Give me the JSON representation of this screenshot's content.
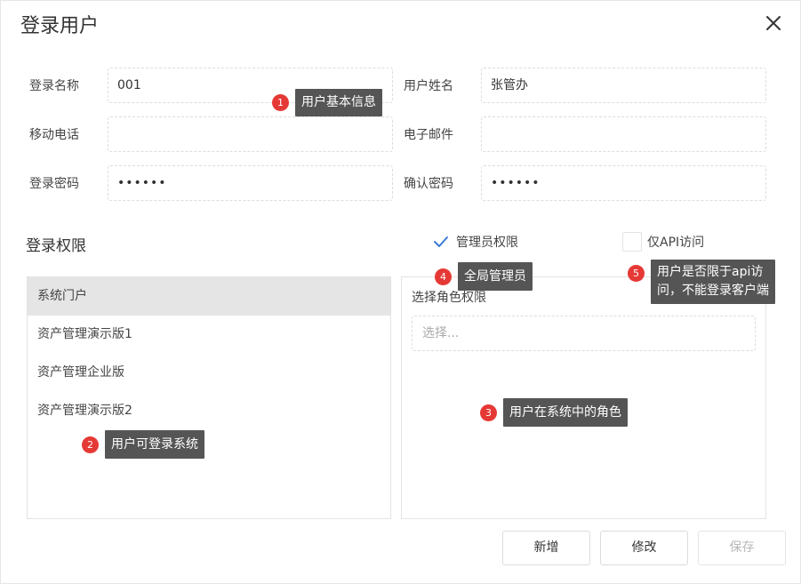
{
  "dialog": {
    "title": "登录用户"
  },
  "form": {
    "login_name": {
      "label": "登录名称",
      "value": "001"
    },
    "user_name": {
      "label": "用户姓名",
      "value": "张管办"
    },
    "mobile": {
      "label": "移动电话",
      "value": ""
    },
    "email": {
      "label": "电子邮件",
      "value": ""
    },
    "password": {
      "label": "登录密码",
      "value": "••••••"
    },
    "confirm_password": {
      "label": "确认密码",
      "value": "••••••"
    }
  },
  "permissions": {
    "title": "登录权限",
    "admin": {
      "label": "管理员权限",
      "checked": true
    },
    "api_only": {
      "label": "仅API访问",
      "checked": false
    },
    "systems": [
      "系统门户",
      "资产管理演示版1",
      "资产管理企业版",
      "资产管理演示版2"
    ],
    "role_label": "选择角色权限",
    "role_placeholder": "选择..."
  },
  "annotations": [
    {
      "num": "1",
      "text": "用户基本信息"
    },
    {
      "num": "2",
      "text": "用户可登录系统"
    },
    {
      "num": "3",
      "text": "用户在系统中的角色"
    },
    {
      "num": "4",
      "text": "全局管理员"
    },
    {
      "num": "5",
      "line1": "用户是否限于api访",
      "line2": "问，不能登录客户端"
    }
  ],
  "buttons": {
    "add": "新增",
    "edit": "修改",
    "save": "保存"
  },
  "icons": {
    "close": "close-icon",
    "check": "check-icon"
  },
  "colors": {
    "badge": "#e53935",
    "tooltip": "#555555",
    "check": "#3a7bd5",
    "selected_item": "#e5e5e5"
  }
}
